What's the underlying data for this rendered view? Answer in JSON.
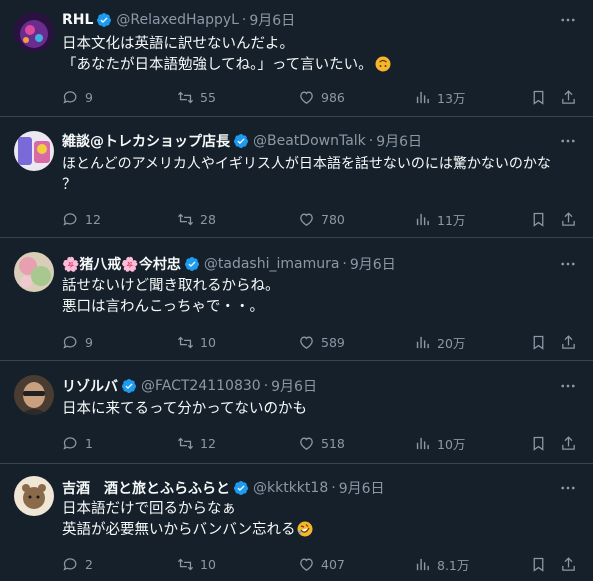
{
  "tweets": [
    {
      "name": "RHL",
      "handle": "@RelaxedHappyL",
      "sep": "·",
      "date": "9月6日",
      "lines": [
        "日本文化は英語に訳せないんだよ。",
        "「あなたが日本語勉強してね。」って言いたい。"
      ],
      "replies": "9",
      "retweets": "55",
      "likes": "986",
      "views": "13万",
      "avatar_color": "#3a1c5c",
      "emoji": "upside-down-face"
    },
    {
      "name": "雑談@トレカショップ店長",
      "handle": "@BeatDownTalk",
      "sep": "·",
      "date": "9月6日",
      "lines": [
        "ほとんどのアメリカ人やイギリス人が日本語を話せないのには驚かないのかな",
        "？"
      ],
      "replies": "12",
      "retweets": "28",
      "likes": "780",
      "views": "11万",
      "avatar_color": "#e8e4f0"
    },
    {
      "name": "🌸猪八戒🌸今村忠",
      "handle": "@tadashi_imamura",
      "sep": "·",
      "date": "9月6日",
      "lines": [
        "話せないけど聞き取れるからね。",
        "悪口は言わんこっちゃで・・。"
      ],
      "replies": "9",
      "retweets": "10",
      "likes": "589",
      "views": "20万",
      "avatar_color": "#d8c8a8"
    },
    {
      "name": "リゾルバ",
      "handle": "@FACT24110830",
      "sep": "·",
      "date": "9月6日",
      "lines": [
        "日本に来てるって分かってないのかも"
      ],
      "replies": "1",
      "retweets": "12",
      "likes": "518",
      "views": "10万",
      "avatar_color": "#6a5a48"
    },
    {
      "name": "吉酒　酒と旅とふらふらと",
      "handle": "@kktkkt18",
      "sep": "·",
      "date": "9月6日",
      "lines": [
        "日本語だけで回るからなぁ",
        "英語が必要無いからバンバン忘れる"
      ],
      "replies": "2",
      "retweets": "10",
      "likes": "407",
      "views": "8.1万",
      "avatar_color": "#e8dcc8",
      "emoji": "rolling-on-floor-laughing"
    }
  ],
  "colors": {
    "background": "#15202b",
    "text": "#f7f9f9",
    "muted": "#8b98a5",
    "verified": "#1d9bf0",
    "divider": "#38444d"
  }
}
